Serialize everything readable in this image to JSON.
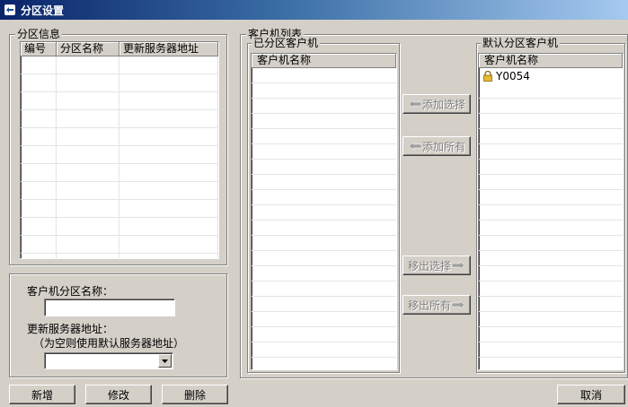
{
  "window": {
    "title": "分区设置"
  },
  "partition_info": {
    "legend": "分区信息",
    "columns": [
      "编号",
      "分区名称",
      "更新服务器地址"
    ]
  },
  "form": {
    "name_label": "客户机分区名称：",
    "name_value": "",
    "server_label": "更新服务器地址：",
    "server_hint": "（为空则使用默认服务器地址）",
    "server_value": ""
  },
  "client_list": {
    "legend": "客户机列表",
    "assigned": {
      "legend": "已分区客户机",
      "column": "客户机名称",
      "items": []
    },
    "default": {
      "legend": "默认分区客户机",
      "column": "客户机名称",
      "items": [
        "Y0054"
      ]
    }
  },
  "move_buttons": {
    "add_selected": "添加选择",
    "add_all": "添加所有",
    "remove_selected": "移出选择",
    "remove_all": "移出所有"
  },
  "bottom_buttons": {
    "new": "新增",
    "edit": "修改",
    "delete": "删除",
    "cancel": "取消"
  },
  "colors": {
    "face": "#d4d0c8",
    "title_start": "#0a246a",
    "title_end": "#a6caf0",
    "lock_icon": "#e8b830"
  },
  "icons": {
    "window": "app-icon",
    "client_item": "lock-icon",
    "add": "left-arrow-icon",
    "remove": "right-arrow-icon",
    "dropdown": "chevron-down-icon"
  }
}
